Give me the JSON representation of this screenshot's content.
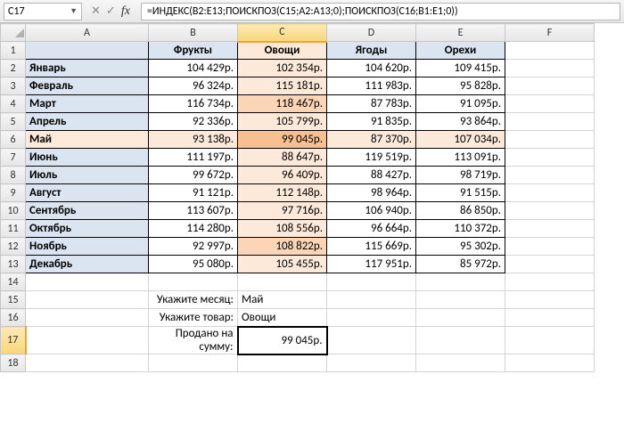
{
  "namebox": "C17",
  "formula": "=ИНДЕКС(B2:E13;ПОИСКПОЗ(C15;A2:A13;0);ПОИСКПОЗ(C16;B1:E1;0))",
  "columns": [
    "A",
    "B",
    "C",
    "D",
    "E",
    "F"
  ],
  "rows": [
    "1",
    "2",
    "3",
    "4",
    "5",
    "6",
    "7",
    "8",
    "9",
    "10",
    "11",
    "12",
    "13",
    "14",
    "15",
    "16",
    "17",
    "18"
  ],
  "headers": {
    "b": "Фрукты",
    "c": "Овощи",
    "d": "Ягоды",
    "e": "Орехи"
  },
  "months": [
    "Январь",
    "Февраль",
    "Март",
    "Апрель",
    "Май",
    "Июнь",
    "Июль",
    "Август",
    "Сентябрь",
    "Октябрь",
    "Ноябрь",
    "Декабрь"
  ],
  "data": {
    "r2": {
      "b": "104 429р.",
      "c": "102 354р.",
      "d": "104 620р.",
      "e": "109 415р."
    },
    "r3": {
      "b": "96 324р.",
      "c": "115 181р.",
      "d": "111 983р.",
      "e": "95 828р."
    },
    "r4": {
      "b": "116 734р.",
      "c": "118 467р.",
      "d": "87 783р.",
      "e": "91 095р."
    },
    "r5": {
      "b": "92 336р.",
      "c": "105 799р.",
      "d": "91 835р.",
      "e": "93 864р."
    },
    "r6": {
      "b": "93 138р.",
      "c": "99 045р.",
      "d": "87 370р.",
      "e": "107 034р."
    },
    "r7": {
      "b": "111 197р.",
      "c": "88 647р.",
      "d": "119 519р.",
      "e": "113 091р."
    },
    "r8": {
      "b": "99 672р.",
      "c": "96 409р.",
      "d": "88 427р.",
      "e": "98 719р."
    },
    "r9": {
      "b": "91 121р.",
      "c": "112 148р.",
      "d": "98 964р.",
      "e": "91 515р."
    },
    "r10": {
      "b": "113 607р.",
      "c": "97 716р.",
      "d": "106 940р.",
      "e": "86 850р."
    },
    "r11": {
      "b": "114 280р.",
      "c": "108 556р.",
      "d": "96 664р.",
      "e": "110 372р."
    },
    "r12": {
      "b": "92 997р.",
      "c": "108 822р.",
      "d": "115 669р.",
      "e": "95 302р."
    },
    "r13": {
      "b": "95 080р.",
      "c": "105 455р.",
      "d": "117 951р.",
      "e": "85 972р."
    }
  },
  "labels": {
    "month_prompt": "Укажите месяц:",
    "product_prompt": "Укажите товар:",
    "sold_prompt": "Продано на сумму:"
  },
  "inputs": {
    "month": "Май",
    "product": "Овощи",
    "result": "99 045р."
  },
  "chart_data": {
    "type": "table",
    "title": "",
    "row_labels": [
      "Январь",
      "Февраль",
      "Март",
      "Апрель",
      "Май",
      "Июнь",
      "Июль",
      "Август",
      "Сентябрь",
      "Октябрь",
      "Ноябрь",
      "Декабрь"
    ],
    "col_labels": [
      "Фрукты",
      "Овощи",
      "Ягоды",
      "Орехи"
    ],
    "unit": "р.",
    "values": [
      [
        104429,
        102354,
        104620,
        109415
      ],
      [
        96324,
        115181,
        111983,
        95828
      ],
      [
        116734,
        118467,
        87783,
        91095
      ],
      [
        92336,
        105799,
        91835,
        93864
      ],
      [
        93138,
        99045,
        87370,
        107034
      ],
      [
        111197,
        88647,
        119519,
        113091
      ],
      [
        99672,
        96409,
        88427,
        98719
      ],
      [
        91121,
        112148,
        98964,
        91515
      ],
      [
        113607,
        97716,
        106940,
        86850
      ],
      [
        114280,
        108556,
        96664,
        110372
      ],
      [
        92997,
        108822,
        115669,
        95302
      ],
      [
        95080,
        105455,
        117951,
        85972
      ]
    ]
  }
}
